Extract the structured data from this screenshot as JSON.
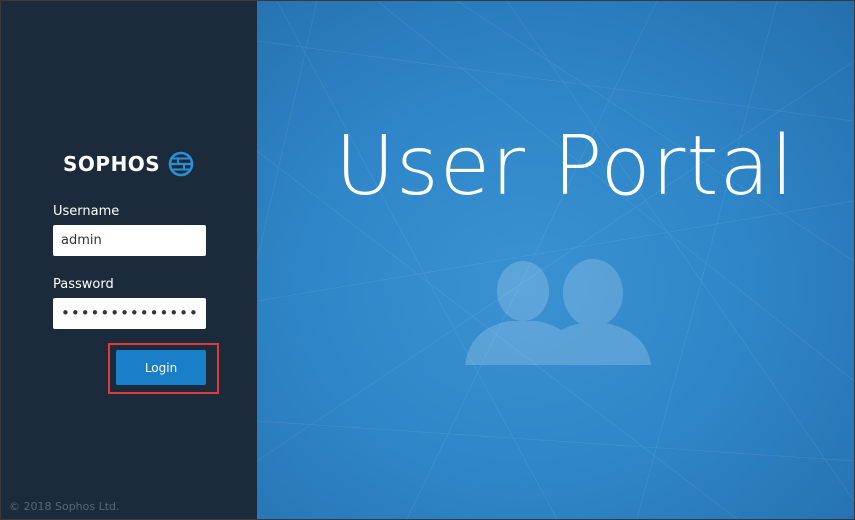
{
  "brand": {
    "name": "SOPHOS",
    "logo_icon": "globe-icon",
    "accent_color": "#1a7fc9"
  },
  "login_form": {
    "username_label": "Username",
    "username_value": "admin",
    "password_label": "Password",
    "password_value": "••••••••••••••",
    "login_label": "Login"
  },
  "footer": {
    "copyright": "© 2018 Sophos Ltd."
  },
  "hero": {
    "title": "User Portal",
    "icon": "users-icon"
  },
  "colors": {
    "sidebar_bg": "#1c2b3b",
    "hero_bg": "#2f87c9",
    "highlight": "#e03a3a"
  }
}
